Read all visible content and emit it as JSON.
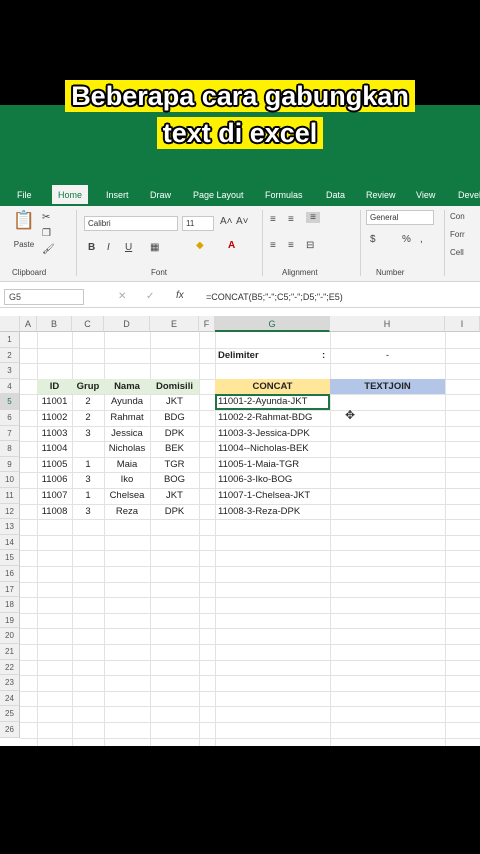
{
  "caption": {
    "line1": "Beberapa cara gabungkan",
    "line2": "text di excel"
  },
  "ribbon_tabs": [
    "File",
    "Home",
    "Insert",
    "Draw",
    "Page Layout",
    "Formulas",
    "Data",
    "Review",
    "View",
    "Devel"
  ],
  "ribbon": {
    "paste_label": "Paste",
    "clipboard_label": "Clipboard",
    "font_name": "Calibri",
    "font_size": "11",
    "font_label": "Font",
    "alignment_label": "Alignment",
    "number_format": "General",
    "number_label": "Number",
    "bold": "B",
    "italic": "I",
    "underline": "U",
    "style_items": [
      "Con",
      "Forr",
      "Cell"
    ]
  },
  "formula_bar": {
    "name_box": "G5",
    "fx": "fx",
    "formula": "=CONCAT(B5;\"-\";C5;\"-\";D5;\"-\";E5)"
  },
  "sheet": {
    "columns": [
      "A",
      "B",
      "C",
      "D",
      "E",
      "F",
      "G",
      "H",
      "I"
    ],
    "rows": [
      "1",
      "2",
      "3",
      "4",
      "5",
      "6",
      "7",
      "8",
      "9",
      "10",
      "11",
      "12",
      "13",
      "14",
      "15",
      "16",
      "17",
      "18",
      "19",
      "20",
      "21",
      "22",
      "23",
      "24",
      "25",
      "26"
    ],
    "delimiter_label": "Delimiter",
    "delimiter_colon": ":",
    "delimiter_value": "-",
    "headers": {
      "id": "ID",
      "grup": "Grup",
      "nama": "Nama",
      "domisili": "Domisili",
      "concat": "CONCAT",
      "textjoin": "TEXTJOIN"
    },
    "data": [
      {
        "id": "11001",
        "grup": "2",
        "nama": "Ayunda",
        "domisili": "JKT",
        "concat": "11001-2-Ayunda-JKT"
      },
      {
        "id": "11002",
        "grup": "2",
        "nama": "Rahmat",
        "domisili": "BDG",
        "concat": "11002-2-Rahmat-BDG"
      },
      {
        "id": "11003",
        "grup": "3",
        "nama": "Jessica",
        "domisili": "DPK",
        "concat": "11003-3-Jessica-DPK"
      },
      {
        "id": "11004",
        "grup": "",
        "nama": "Nicholas",
        "domisili": "BEK",
        "concat": "11004--Nicholas-BEK"
      },
      {
        "id": "11005",
        "grup": "1",
        "nama": "Maia",
        "domisili": "TGR",
        "concat": "11005-1-Maia-TGR"
      },
      {
        "id": "11006",
        "grup": "3",
        "nama": "Iko",
        "domisili": "BOG",
        "concat": "11006-3-Iko-BOG"
      },
      {
        "id": "11007",
        "grup": "1",
        "nama": "Chelsea",
        "domisili": "JKT",
        "concat": "11007-1-Chelsea-JKT"
      },
      {
        "id": "11008",
        "grup": "3",
        "nama": "Reza",
        "domisili": "DPK",
        "concat": "11008-3-Reza-DPK"
      }
    ]
  }
}
